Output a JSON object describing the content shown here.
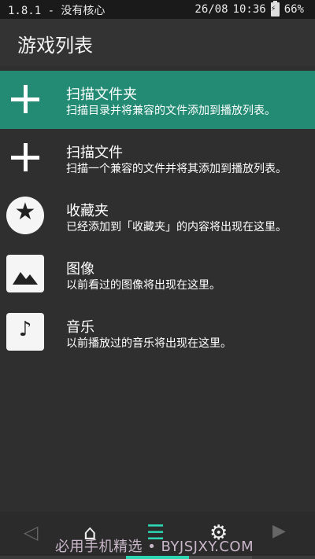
{
  "status": {
    "left_text": "1.8.1 - 没有核心",
    "date": "26/08",
    "time": "10:36",
    "battery": "66%"
  },
  "header": {
    "title": "游戏列表"
  },
  "items": [
    {
      "title": "扫描文件夹",
      "sub": "扫描目录并将兼容的文件添加到播放列表。",
      "icon": "plus-icon",
      "selected": true
    },
    {
      "title": "扫描文件",
      "sub": "扫描一个兼容的文件并将其添加到播放列表。",
      "icon": "plus-icon",
      "selected": false
    },
    {
      "title": "收藏夹",
      "sub": "已经添加到「收藏夹」的内容将出现在这里。",
      "icon": "star-icon",
      "selected": false
    },
    {
      "title": "图像",
      "sub": "以前看过的图像将出现在这里。",
      "icon": "image-icon",
      "selected": false
    },
    {
      "title": "音乐",
      "sub": "以前播放过的音乐将出现在这里。",
      "icon": "music-icon",
      "selected": false
    }
  ],
  "nav": {
    "back": "◁",
    "home": "⌂",
    "list": "☰",
    "gear": "⚙",
    "play": "▶"
  },
  "watermark": "必用手机精选 • BYJSJXY.COM",
  "colors": {
    "accent": "#238b74",
    "nav_accent": "#2dd7b4"
  }
}
